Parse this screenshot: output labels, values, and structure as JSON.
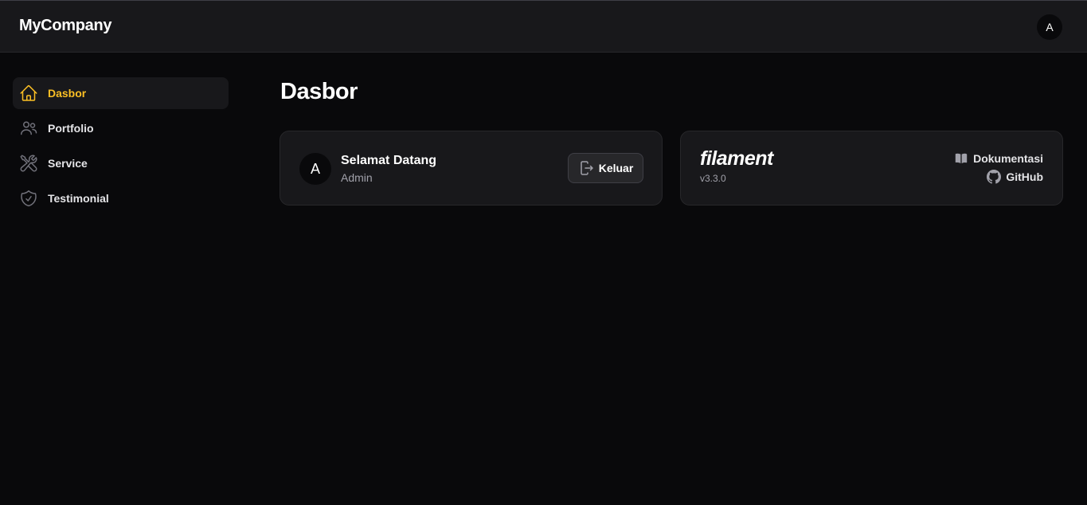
{
  "header": {
    "brand": "MyCompany",
    "avatar_initial": "A"
  },
  "sidebar": {
    "items": [
      {
        "label": "Dasbor",
        "icon": "home-icon",
        "active": true
      },
      {
        "label": "Portfolio",
        "icon": "users-icon",
        "active": false
      },
      {
        "label": "Service",
        "icon": "wrench-screwdriver-icon",
        "active": false
      },
      {
        "label": "Testimonial",
        "icon": "shield-check-icon",
        "active": false
      }
    ]
  },
  "main": {
    "title": "Dasbor",
    "welcome_card": {
      "avatar_initial": "A",
      "title": "Selamat Datang",
      "subtitle": "Admin",
      "logout_label": "Keluar"
    },
    "filament_card": {
      "logo_text": "filament",
      "version": "v3.3.0",
      "docs_label": "Dokumentasi",
      "github_label": "GitHub"
    }
  },
  "colors": {
    "accent": "#fbbf24",
    "background": "#09090b",
    "surface": "#18181b"
  }
}
